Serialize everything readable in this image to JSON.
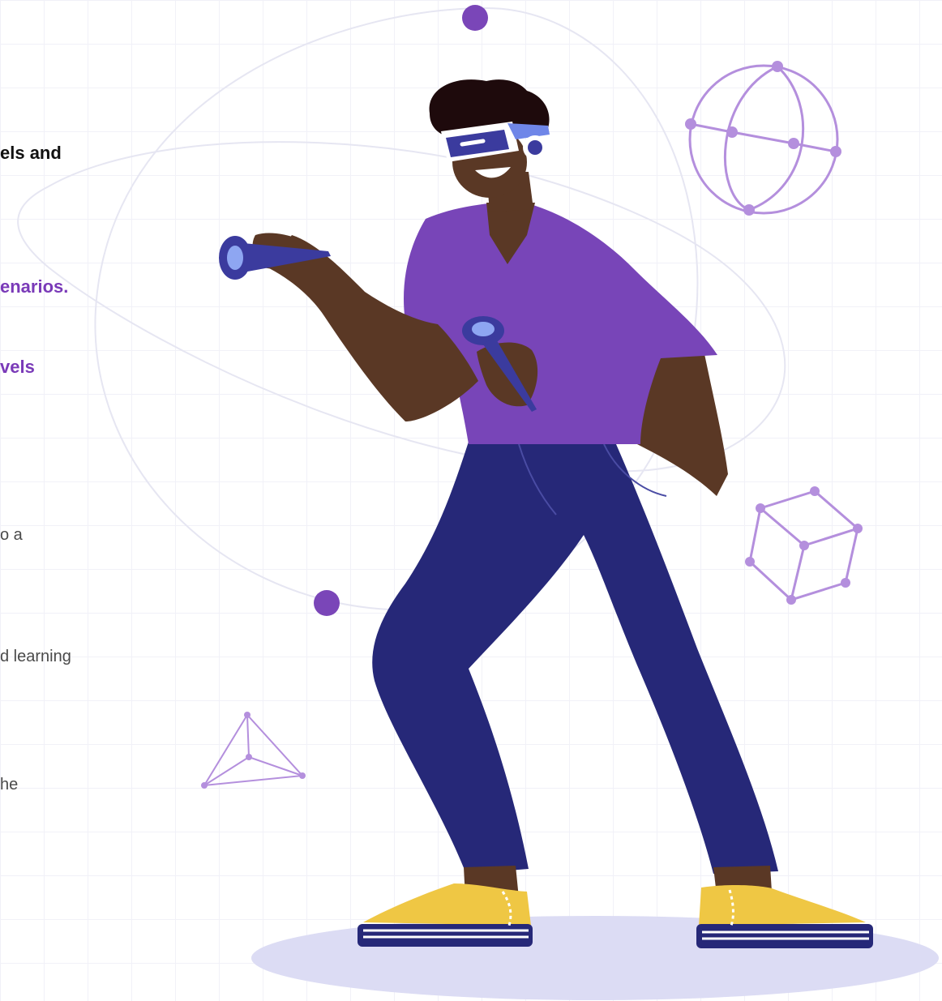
{
  "text_fragments": {
    "heading_line": "els and",
    "accent_line_1": "enarios.",
    "accent_line_2": "vels",
    "body_line_1": "o a",
    "body_line_2": "d learning",
    "body_line_3": "he"
  },
  "colors": {
    "accent_purple": "#7a46b8",
    "shirt_purple": "#7845b8",
    "pants_navy": "#262878",
    "skin": "#5a3825",
    "hair": "#1e0a0c",
    "shoes_yellow": "#efc744",
    "floor_shadow": "#dcdcf4",
    "wireframe_lilac": "#b48fdd",
    "controller_blue": "#3b3b9e",
    "headset_blue": "#6f86e8"
  },
  "icons": {
    "sphere": "wireframe-sphere-icon",
    "cube": "wireframe-cube-icon",
    "pyramid": "wireframe-pyramid-icon"
  }
}
